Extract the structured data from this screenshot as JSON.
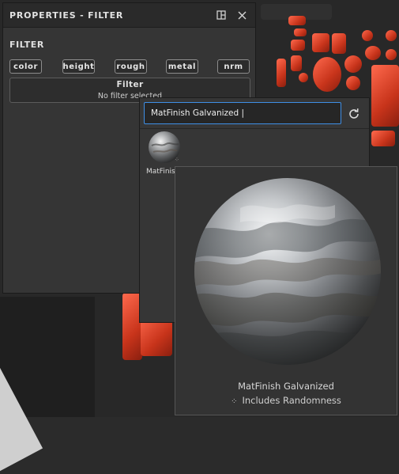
{
  "panel": {
    "title": "PROPERTIES - FILTER",
    "section_label": "FILTER",
    "chips": [
      "color",
      "height",
      "rough",
      "metal",
      "nrm"
    ],
    "filter_header": "Filter",
    "filter_status": "No filter selected"
  },
  "browser": {
    "search_value": "MatFinish Galvanized",
    "thumb_label": "MatFinish Galvanized"
  },
  "preview": {
    "name": "MatFinish Galvanized",
    "randomness": "Includes Randomness"
  },
  "colors": {
    "accent": "#3f8fe6",
    "mesh_red": "#e2462a"
  }
}
